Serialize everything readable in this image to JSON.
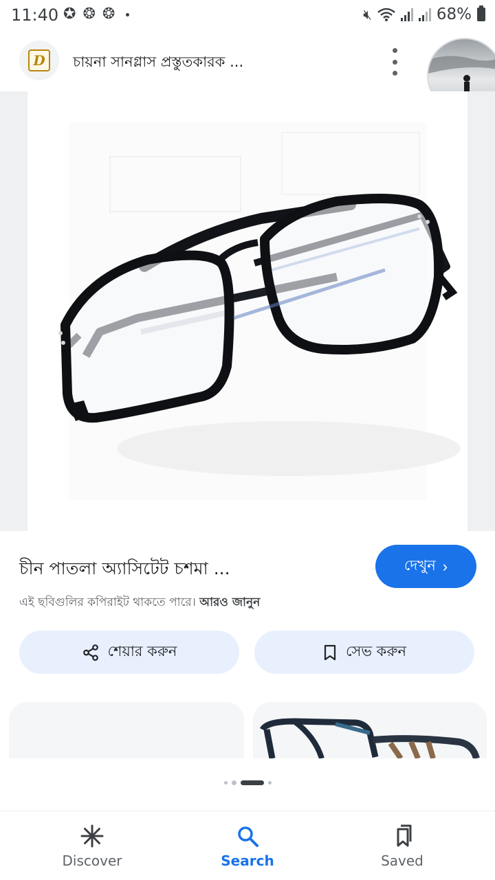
{
  "status_bar": {
    "time": "11:40",
    "battery": "68%"
  },
  "header": {
    "favicon_letter": "D",
    "site_title": "চায়না সানগ্লাস প্রস্তুতকারক ..."
  },
  "result": {
    "title": "চীন পাতলা অ্যাসিটেট চশমা ...",
    "visit_label": "দেখুন",
    "copyright_text": "এই ছবিগুলির কপিরাইট থাকতে পারে।",
    "learn_more": "আরও জানুন"
  },
  "actions": {
    "share_label": "শেয়ার করুন",
    "save_label": "সেভ করুন"
  },
  "bottom_nav": {
    "discover": "Discover",
    "search": "Search",
    "saved": "Saved"
  },
  "colors": {
    "accent": "#1a73e8",
    "pill_bg": "#e8f0fe"
  }
}
